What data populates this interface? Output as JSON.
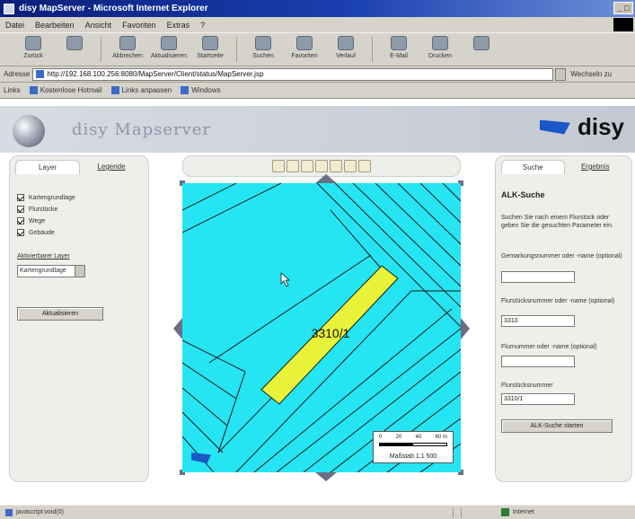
{
  "window": {
    "title": "disy MapServer - Microsoft Internet Explorer",
    "controls": "_ □ ×"
  },
  "menu": [
    "Datei",
    "Bearbeiten",
    "Ansicht",
    "Favoriten",
    "Extras",
    "?"
  ],
  "toolbar": [
    {
      "label": "Zurück",
      "icon": "back-icon"
    },
    {
      "label": "",
      "icon": "forward-icon"
    },
    {
      "label": "Abbrechen",
      "icon": "stop-icon"
    },
    {
      "label": "Aktualisieren",
      "icon": "refresh-icon"
    },
    {
      "label": "Startseite",
      "icon": "home-icon"
    },
    {
      "label": "Suchen",
      "icon": "search-icon"
    },
    {
      "label": "Favoriten",
      "icon": "favorites-icon"
    },
    {
      "label": "Verlauf",
      "icon": "history-icon"
    },
    {
      "label": "E-Mail",
      "icon": "mail-icon"
    },
    {
      "label": "Drucken",
      "icon": "print-icon"
    },
    {
      "label": "",
      "icon": "edit-icon"
    }
  ],
  "address": {
    "label": "Adresse",
    "url": "http://192.168.100.256:8080/MapServer/Client/status/MapServer.jsp",
    "go": "Wechseln zu"
  },
  "links": {
    "label": "Links",
    "items": [
      "Kostenlose Hotmail",
      "Links anpassen",
      "Windows"
    ]
  },
  "banner": {
    "app_title": "disy Mapserver",
    "brand": "disy"
  },
  "left_panel": {
    "tabs": {
      "active": "Layer",
      "inactive": "Legende"
    },
    "layers": [
      "Kartengrundlage",
      "Flurstücke",
      "Wege",
      "Gebäude"
    ],
    "active_layer_label": "Aktivierbarer Layer",
    "active_layer_value": "Kartengrundlage",
    "refresh_button": "Aktualisieren"
  },
  "map": {
    "parcel_label": "3310/1",
    "scale_ticks": [
      "0",
      "20",
      "40",
      "60 m"
    ],
    "scale_text": "Maßstab 1:1 500",
    "colors": {
      "water": "#25e5f2",
      "highlight": "#e8f238",
      "lines": "#1a1a1a"
    }
  },
  "map_tools": [
    "pan-tool-icon",
    "zoom-in-icon",
    "zoom-in-box-icon",
    "zoom-out-icon",
    "overview-icon",
    "print-map-icon",
    "info-icon"
  ],
  "right_panel": {
    "tabs": {
      "active": "Suche",
      "inactive": "Ergebnis"
    },
    "title": "ALK-Suche",
    "intro": "Suchen Sie nach einem Flurstück oder geben Sie die gesuchten Parameter ein.",
    "fields": [
      {
        "label": "Gemarkungsnummer oder -name (optional)",
        "value": ""
      },
      {
        "label": "Flurstücksnummer oder -name (optional)",
        "value": "3310"
      },
      {
        "label": "Flurnummer oder -name (optional)",
        "value": ""
      },
      {
        "label": "Flurstücksnummer",
        "value": "3310/1"
      }
    ],
    "search_button": "ALK-Suche starten"
  },
  "status": {
    "message": "javascript:void(0)",
    "zone": "Internet"
  }
}
